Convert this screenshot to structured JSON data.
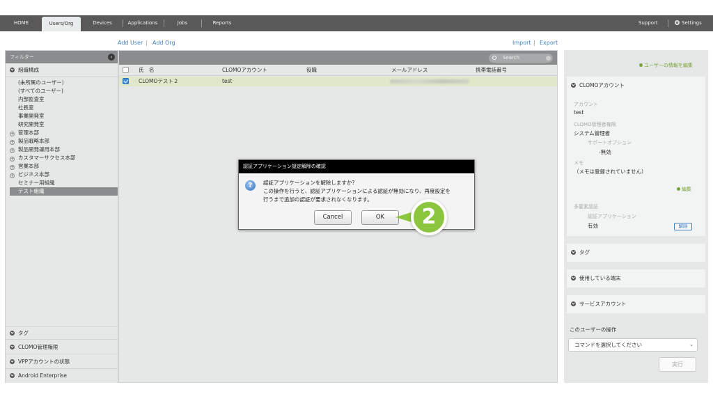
{
  "nav": {
    "tabs": [
      "HOME",
      "Users/Org",
      "Devices",
      "Applications",
      "Jobs",
      "Reports"
    ],
    "active_tab": "Users/Org",
    "support": "Support",
    "settings": "Settings"
  },
  "links": {
    "add_user": "Add User",
    "add_org": "Add Org",
    "import": "Import",
    "export": "Export",
    "sep": "|"
  },
  "left": {
    "filter_label": "フィルター",
    "org_section": "組織構成",
    "org_items": [
      {
        "label": "(未所属のユーザー)",
        "expandable": false
      },
      {
        "label": "(すべてのユーザー)",
        "expandable": false
      },
      {
        "label": "内部監査室",
        "expandable": false
      },
      {
        "label": "社長室",
        "expandable": false
      },
      {
        "label": "事業開発室",
        "expandable": false
      },
      {
        "label": "研究開発室",
        "expandable": false
      },
      {
        "label": "管理本部",
        "expandable": true
      },
      {
        "label": "製品戦略本部",
        "expandable": true
      },
      {
        "label": "製品開発運用本部",
        "expandable": true
      },
      {
        "label": "カスタマーサクセス本部",
        "expandable": true
      },
      {
        "label": "営業本部",
        "expandable": true
      },
      {
        "label": "ビジネス本部",
        "expandable": true
      },
      {
        "label": "セミナー用組織",
        "expandable": false
      },
      {
        "label": "テスト組織",
        "expandable": false,
        "selected": true
      }
    ],
    "bottom_sections": [
      "タグ",
      "CLOMO管理権限",
      "VPPアカウントの状態",
      "Android Enterprise"
    ]
  },
  "table": {
    "search_placeholder": "Search",
    "columns": [
      "氏　名",
      "CLOMOアカウント",
      "役職",
      "メールアドレス",
      "携帯電話番号"
    ],
    "rows": [
      {
        "name": "CLOMOテスト２",
        "account": "test",
        "title": "",
        "phone": "",
        "checked": true
      }
    ]
  },
  "dialog": {
    "title": "認証アプリケーション設定解除の確認",
    "line1": "認証アプリケーションを解除しますか?",
    "line2": "この操作を行うと、認証アプリケーションによる認証が無効になり、再度設定を",
    "line3": "行うまで追加の認証が要求されなくなります。",
    "cancel": "Cancel",
    "ok": "OK",
    "icon": "question-icon"
  },
  "callout": "2",
  "right": {
    "edit_user_info": "ユーザーの情報を編集",
    "account_section": "CLOMOアカウント",
    "account_label": "アカウント",
    "account_value": "test",
    "admin_label": "CLOMO管理者権限",
    "admin_value": "システム管理者",
    "support_label": "サポートオプション",
    "support_value": "-無効",
    "memo_label": "メモ",
    "memo_value": "（メモは登録されていません）",
    "edit": "編集",
    "mfa_label": "多要素認証",
    "auth_app_label": "認証アプリケーション",
    "auth_app_value": "有効",
    "release": "解除",
    "tag_section": "タグ",
    "devices_section": "使用している端末",
    "service_section": "サービスアカウント",
    "ops_label": "このユーザーの操作",
    "cmd_placeholder": "コマンドを選択してください",
    "exec": "実行"
  },
  "colors": {
    "nav_bg": "#595959",
    "panel_bg": "#e6e8e8",
    "accent_green": "#8cc63e",
    "link_blue": "#3f7fbf",
    "selected_row": "#dfe8c9"
  }
}
